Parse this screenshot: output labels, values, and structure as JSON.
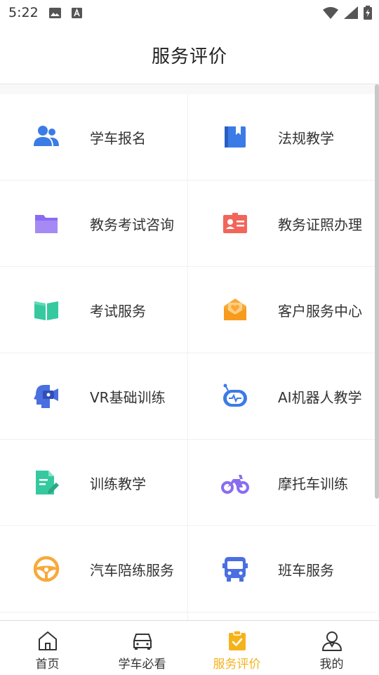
{
  "status_bar": {
    "time": "5:22"
  },
  "header": {
    "title": "服务评价"
  },
  "services": [
    [
      {
        "label": "学车报名",
        "icon": "users-icon"
      },
      {
        "label": "法规教学",
        "icon": "book-bookmark-icon"
      }
    ],
    [
      {
        "label": "教务考试咨询",
        "icon": "folder-icon"
      },
      {
        "label": "教务证照办理",
        "icon": "id-card-icon"
      }
    ],
    [
      {
        "label": "考试服务",
        "icon": "open-book-icon"
      },
      {
        "label": "客户服务中心",
        "icon": "heart-mail-icon"
      }
    ],
    [
      {
        "label": "VR基础训练",
        "icon": "vr-headset-icon"
      },
      {
        "label": "AI机器人教学",
        "icon": "robot-icon"
      }
    ],
    [
      {
        "label": "训练教学",
        "icon": "document-edit-icon"
      },
      {
        "label": "摩托车训练",
        "icon": "motorcycle-icon"
      }
    ],
    [
      {
        "label": "汽车陪练服务",
        "icon": "steering-wheel-icon"
      },
      {
        "label": "班车服务",
        "icon": "bus-icon"
      }
    ]
  ],
  "tabbar": {
    "items": [
      {
        "label": "首页",
        "icon": "home-icon",
        "active": false
      },
      {
        "label": "学车必看",
        "icon": "car-icon",
        "active": false
      },
      {
        "label": "服务评价",
        "icon": "clipboard-check-icon",
        "active": true
      },
      {
        "label": "我的",
        "icon": "user-icon",
        "active": false
      }
    ]
  },
  "colors": {
    "accent": "#f5b31b",
    "blue": "#3b7be6",
    "purple": "#8a6cf0",
    "red": "#f2665a",
    "green": "#36c9a0",
    "orange": "#f8a93a"
  }
}
